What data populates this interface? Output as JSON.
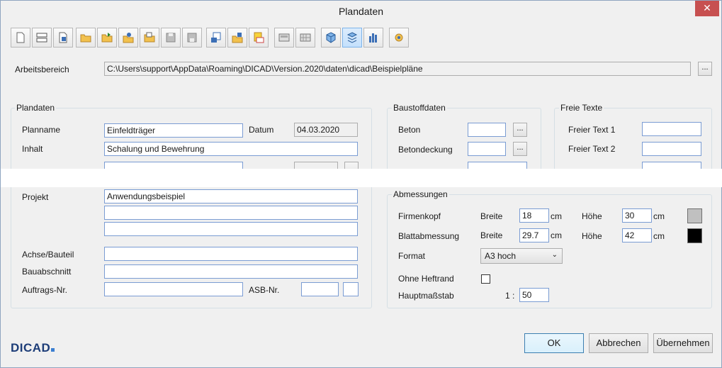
{
  "window": {
    "title": "Plandaten",
    "close_glyph": "✕"
  },
  "toolbar": {
    "icons": [
      "new-icon",
      "layout-icon",
      "document-icon",
      "open-folder-icon",
      "open-folder-arrow-icon",
      "folder-user-icon",
      "folder-copy-icon",
      "save-icon",
      "save-all-icon",
      "export-icon",
      "import-folder-icon",
      "plot-icon",
      "sheet-icon",
      "sheet-grid-icon",
      "cube-icon",
      "cube-layers-icon",
      "chart-icon",
      "settings-icon"
    ]
  },
  "arbeitsbereich": {
    "label": "Arbeitsbereich",
    "path": "C:\\Users\\support\\AppData\\Roaming\\DICAD\\Version.2020\\daten\\dicad\\Beispielpläne",
    "browse": "..."
  },
  "plandaten": {
    "title": "Plandaten",
    "planname_label": "Planname",
    "planname": "Einfeldträger",
    "datum_label": "Datum",
    "datum": "04.03.2020",
    "inhalt_label": "Inhalt",
    "inhalt": "Schalung und Bewehrung",
    "projekt_label": "Projekt",
    "projekt_1": "Anwendungsbeispiel",
    "projekt_2": "",
    "projekt_3": "",
    "achse_label": "Achse/Bauteil",
    "achse": "",
    "bauabschnitt_label": "Bauabschnitt",
    "bauabschnitt": "",
    "auftrags_label": "Auftrags-Nr.",
    "auftrags": "",
    "asb_label": "ASB-Nr.",
    "asb_1": "",
    "asb_2": ""
  },
  "baustoffdaten": {
    "title": "Baustoffdaten",
    "beton_label": "Beton",
    "beton": "",
    "betondeckung_label": "Betondeckung",
    "betondeckung": "",
    "browse": "..."
  },
  "freie_texte": {
    "title": "Freie Texte",
    "text1_label": "Freier Text 1",
    "text1": "",
    "text2_label": "Freier Text 2",
    "text2": ""
  },
  "abmessungen": {
    "title": "Abmessungen",
    "firmenkopf_label": "Firmenkopf",
    "blatt_label": "Blattabmessung",
    "breite_label": "Breite",
    "hoehe_label": "Höhe",
    "unit": "cm",
    "firmenkopf_breite": "18",
    "firmenkopf_hoehe": "30",
    "blatt_breite": "29.7",
    "blatt_hoehe": "42",
    "firmenkopf_color": "#c0c0c0",
    "blatt_color": "#000000",
    "format_label": "Format",
    "format_value": "A3 hoch",
    "heftrand_label": "Ohne Heftrand",
    "massstab_label": "Hauptmaßstab",
    "massstab_prefix": "1 :",
    "massstab": "50"
  },
  "buttons": {
    "ok": "OK",
    "abbrechen": "Abbrechen",
    "uebernehmen": "Übernehmen"
  },
  "logo": {
    "text": "DICAD"
  }
}
